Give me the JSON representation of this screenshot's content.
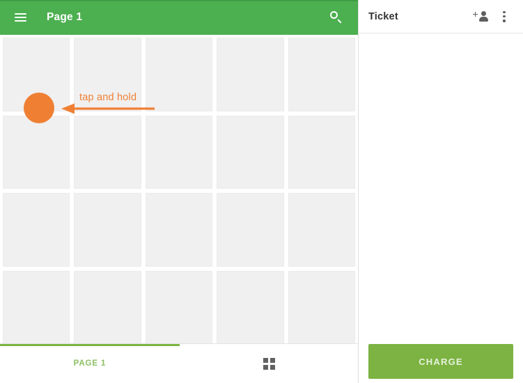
{
  "app": {
    "accent_green": "#4caf50",
    "button_green": "#7cb342",
    "annotation_orange": "#ef8033",
    "tile_gray": "#f0f0f0"
  },
  "appbar": {
    "menu_icon": "hamburger-menu-icon",
    "title": "Page 1",
    "search_icon": "search-icon"
  },
  "catalog": {
    "columns": 5,
    "rows": 4,
    "tiles": [
      {
        "label": ""
      },
      {
        "label": ""
      },
      {
        "label": ""
      },
      {
        "label": ""
      },
      {
        "label": ""
      },
      {
        "label": ""
      },
      {
        "label": ""
      },
      {
        "label": ""
      },
      {
        "label": ""
      },
      {
        "label": ""
      },
      {
        "label": ""
      },
      {
        "label": ""
      },
      {
        "label": ""
      },
      {
        "label": ""
      },
      {
        "label": ""
      },
      {
        "label": ""
      },
      {
        "label": ""
      },
      {
        "label": ""
      },
      {
        "label": ""
      },
      {
        "label": ""
      }
    ]
  },
  "annotation": {
    "text": "tap and hold",
    "marker_icon": "orange-dot-marker",
    "arrow_icon": "left-arrow-icon"
  },
  "bottom_bar": {
    "tab_label": "PAGE 1",
    "grid_icon": "grid-view-icon"
  },
  "ticket": {
    "title": "Ticket",
    "add_customer_icon": "person-add-icon",
    "overflow_icon": "more-vertical-icon",
    "charge_label": "CHARGE"
  }
}
